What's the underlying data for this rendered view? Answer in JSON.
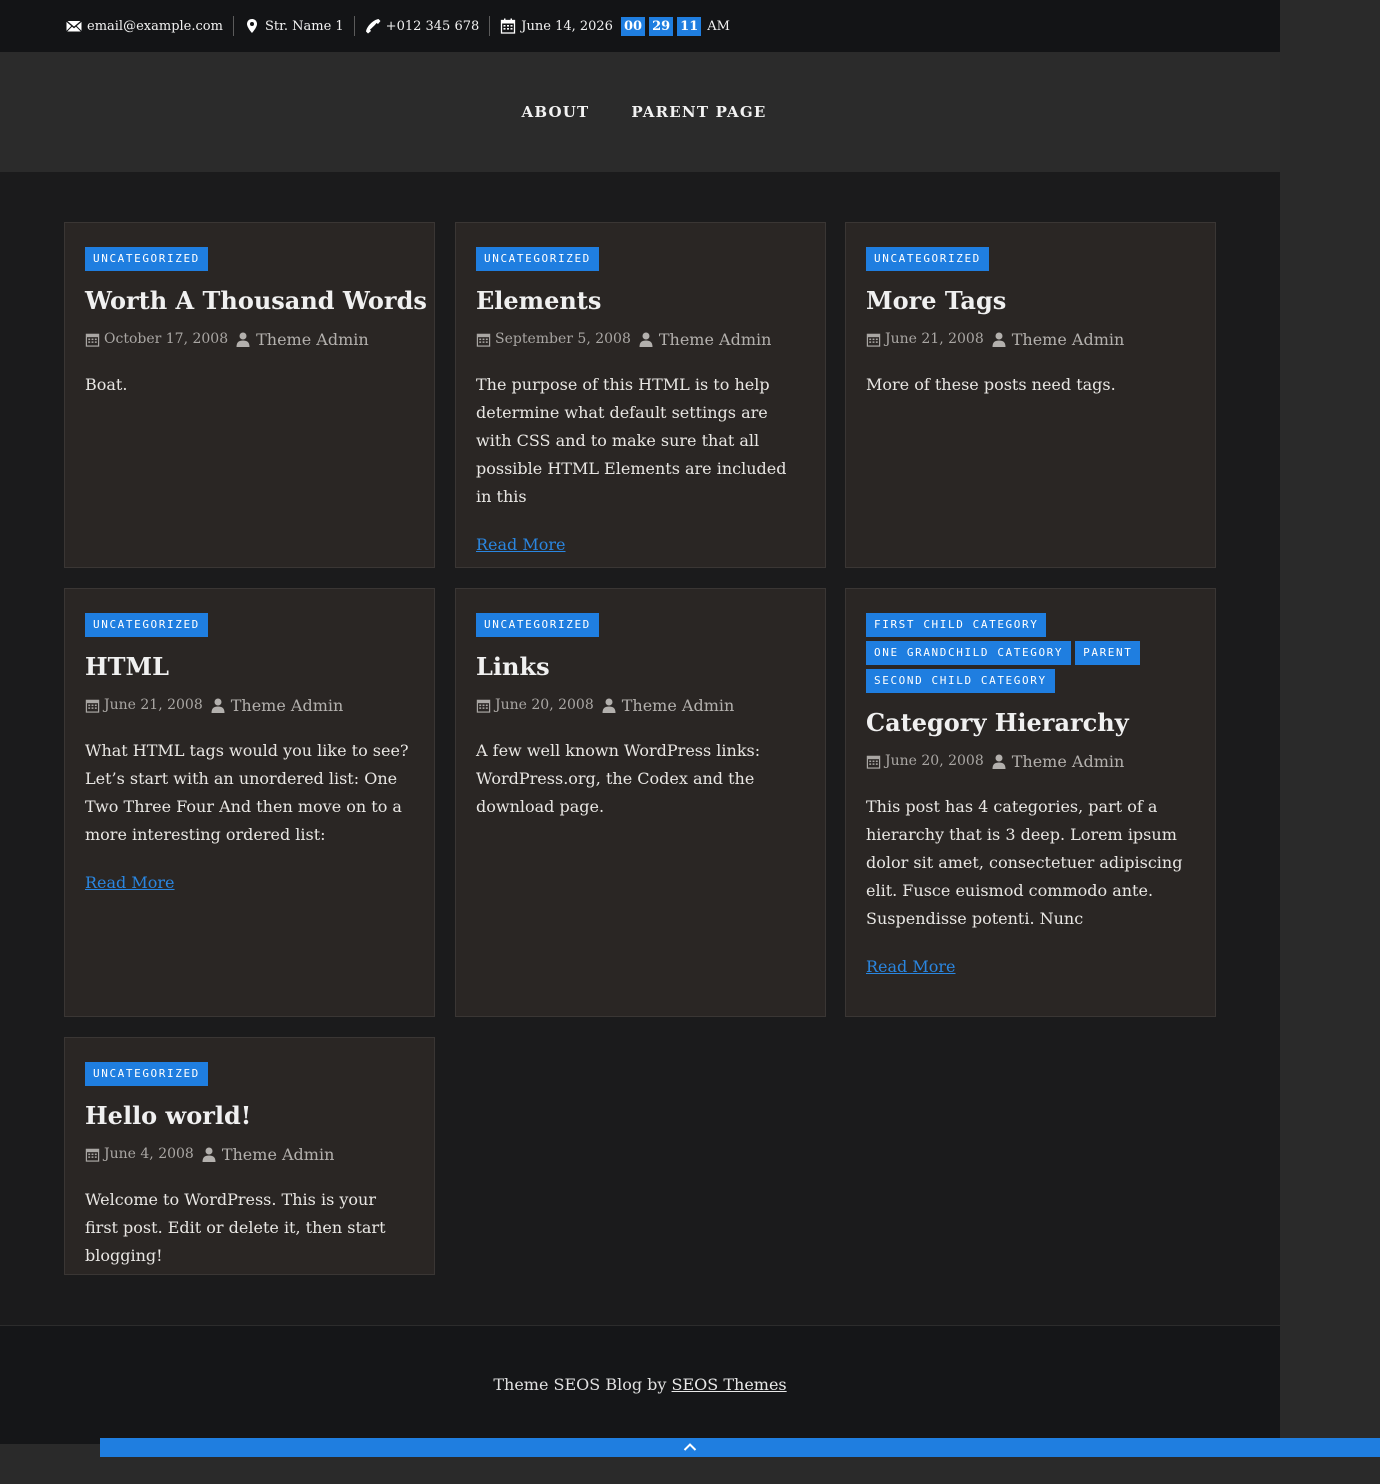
{
  "topbar": {
    "email": "email@example.com",
    "address": "Str. Name 1",
    "phone": "+012 345 678",
    "date": "June 14, 2026",
    "clock": {
      "hours": "00",
      "minutes": "29",
      "seconds": "11",
      "ampm": "AM"
    }
  },
  "nav": {
    "items": [
      "About",
      "Parent Page"
    ]
  },
  "posts": [
    {
      "categories": [
        "Uncategorized"
      ],
      "title": "Worth A Thousand Words",
      "date": "October 17, 2008",
      "author": "Theme Admin",
      "excerpt": "Boat.",
      "read_more": ""
    },
    {
      "categories": [
        "Uncategorized"
      ],
      "title": "Elements",
      "date": "September 5, 2008",
      "author": "Theme Admin",
      "excerpt": "The purpose of this HTML is to help determine what default settings are with CSS and to make sure that all possible HTML Elements are included in this",
      "read_more": "Read More"
    },
    {
      "categories": [
        "Uncategorized"
      ],
      "title": "More Tags",
      "date": "June 21, 2008",
      "author": "Theme Admin",
      "excerpt": "More of these posts need tags.",
      "read_more": ""
    },
    {
      "categories": [
        "Uncategorized"
      ],
      "title": "HTML",
      "date": "June 21, 2008",
      "author": "Theme Admin",
      "excerpt": "What HTML tags would you like to see? Let’s start with an unordered list: One Two Three Four And then move on to a more interesting ordered list:",
      "read_more": "Read More"
    },
    {
      "categories": [
        "Uncategorized"
      ],
      "title": "Links",
      "date": "June 20, 2008",
      "author": "Theme Admin",
      "excerpt": "A few well known WordPress links: WordPress.org, the Codex and the download page.",
      "read_more": ""
    },
    {
      "categories": [
        "First Child Category",
        "One Grandchild Category",
        "Parent",
        "Second Child Category"
      ],
      "title": "Category Hierarchy",
      "date": "June 20, 2008",
      "author": "Theme Admin",
      "excerpt": "This post has 4 categories, part of a hierarchy that is 3 deep. Lorem ipsum dolor sit amet, consectetuer adipiscing elit. Fusce euismod commodo ante. Suspendisse potenti. Nunc",
      "read_more": "Read More"
    },
    {
      "categories": [
        "Uncategorized"
      ],
      "title": "Hello world!",
      "date": "June 4, 2008",
      "author": "Theme Admin",
      "excerpt": "Welcome to WordPress. This is your first post. Edit or delete it, then start blogging!",
      "read_more": ""
    }
  ],
  "footer": {
    "text": "Theme SEOS Blog by",
    "link": "SEOS Themes"
  },
  "colors": {
    "accent": "#1f7ee0",
    "link": "#2a86e0",
    "card_bg": "#2a2624",
    "page_bg": "#1b1b1c"
  },
  "icons": [
    "envelope-icon",
    "map-marker-icon",
    "phone-icon",
    "calendar-icon",
    "user-icon",
    "chevron-up-icon"
  ]
}
